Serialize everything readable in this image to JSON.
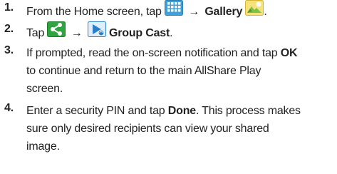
{
  "steps": [
    {
      "number": "1.",
      "text_a": "From the Home screen, tap",
      "arrow": "→",
      "bold_a": "Gallery",
      "icons": [
        "apps-grid-icon",
        "gallery-icon"
      ]
    },
    {
      "number": "2.",
      "text_a": "Tap",
      "arrow": "→",
      "bold_a": "Group Cast",
      "icons": [
        "share-icon",
        "group-cast-icon"
      ]
    },
    {
      "number": "3.",
      "text_a": "If prompted, read the on-screen notification and tap",
      "bold_a": "OK",
      "text_b": "to continue and return to the main AllShare Play",
      "text_c": "screen."
    },
    {
      "number": "4.",
      "text_a": "Enter a security PIN and tap",
      "bold_a": "Done",
      "text_b": ". This process makes",
      "text_c": "sure only desired recipients can view your shared",
      "text_d": "image."
    }
  ],
  "colors": {
    "text": "#222222",
    "apps_icon_blue": "#3f9fd8",
    "share_icon_green": "#2fa33f",
    "group_cast_blue": "#2b7fc7",
    "gallery_yellow": "#f2d64a"
  }
}
